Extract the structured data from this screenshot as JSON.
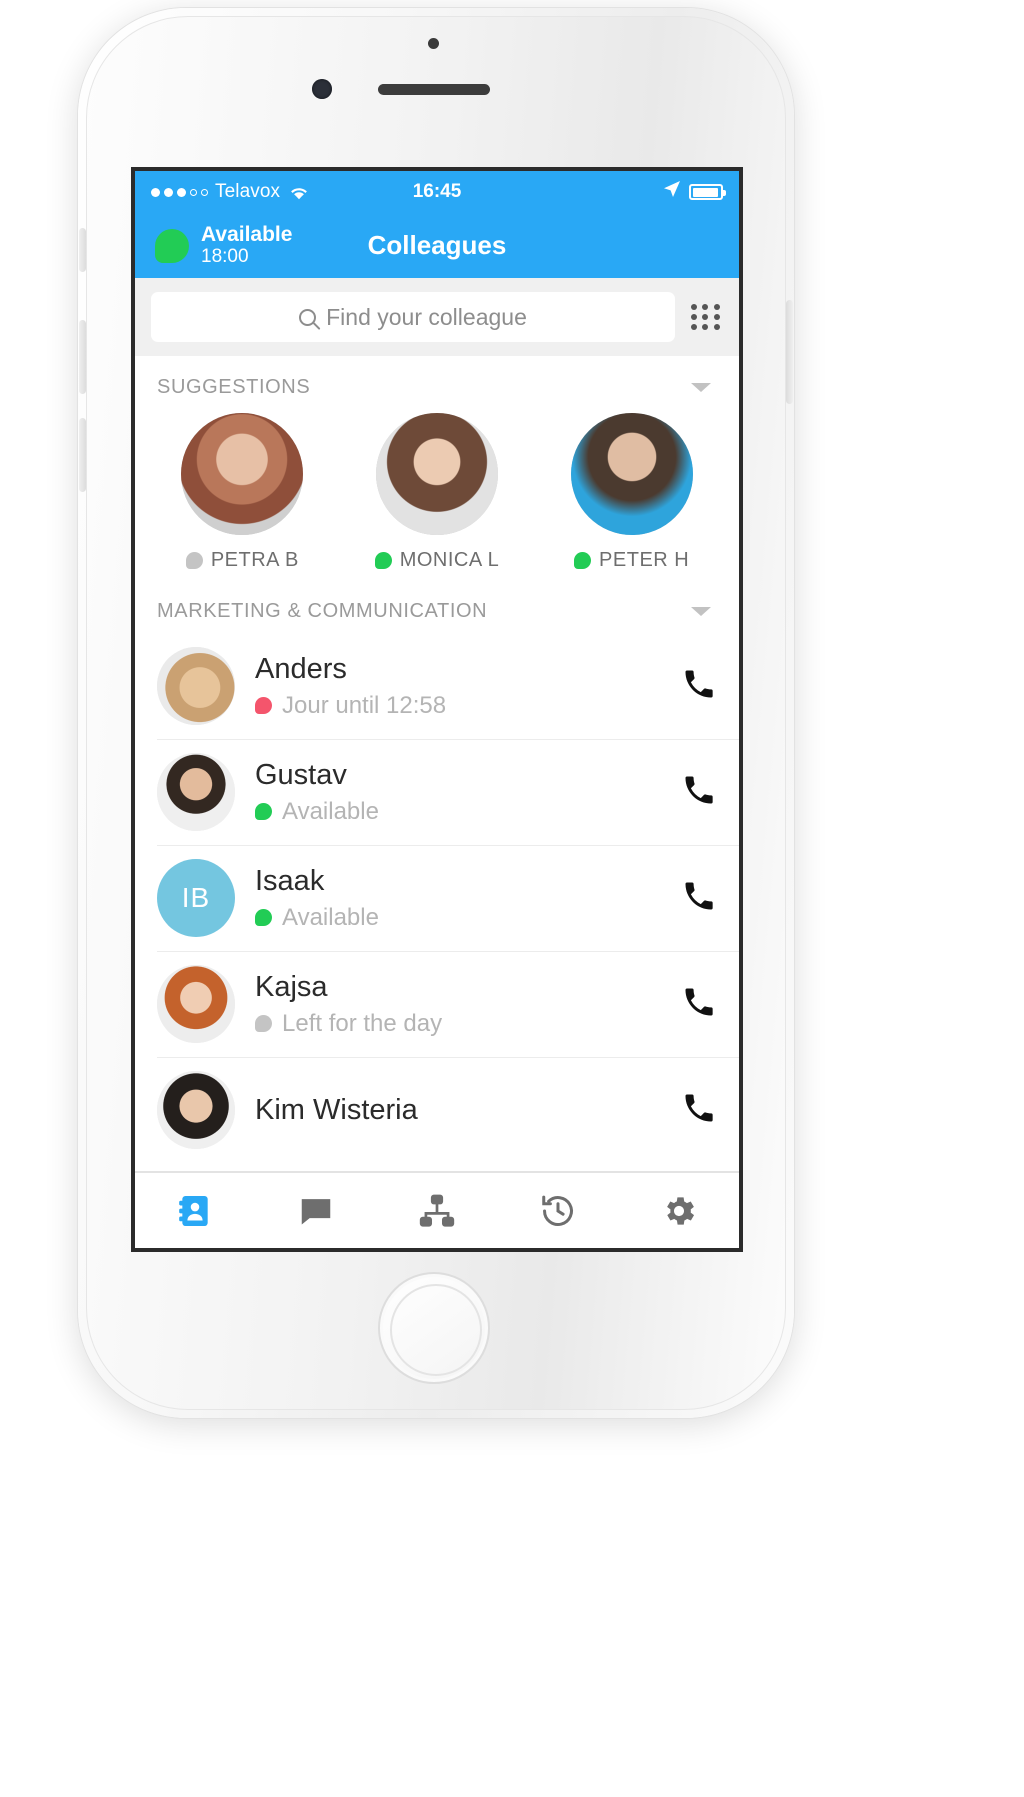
{
  "device": {
    "frame": "iphone-white"
  },
  "status_bar": {
    "signal_dots_filled": 3,
    "signal_dots_total": 5,
    "carrier": "Telavox",
    "wifi_icon": "wifi-icon",
    "time": "16:45",
    "location_icon": "location-arrow-icon",
    "battery_icon": "battery-icon",
    "battery_level_pct": 85
  },
  "navbar": {
    "presence_label": "Available",
    "presence_time": "18:00",
    "presence_color": "#22cc55",
    "title": "Colleagues",
    "background": "#29a8f5"
  },
  "search": {
    "placeholder": "Find your colleague",
    "value": "",
    "search_icon": "search-icon",
    "dialpad_icon": "dialpad-icon"
  },
  "sections": [
    {
      "title": "SUGGESTIONS",
      "collapse_icon": "chevron-down-icon",
      "suggestions": [
        {
          "name": "PETRA B",
          "presence": "grey",
          "avatar": "f-petra"
        },
        {
          "name": "MONICA L",
          "presence": "green",
          "avatar": "f-monica"
        },
        {
          "name": "PETER H",
          "presence": "green",
          "avatar": "f-peter"
        }
      ]
    },
    {
      "title": "MARKETING & COMMUNICATION",
      "collapse_icon": "chevron-down-icon",
      "contacts": [
        {
          "name": "Anders",
          "status": "Jour until 12:58",
          "presence": "red",
          "avatar": "f-dog",
          "initials": "",
          "call_icon": "phone-icon"
        },
        {
          "name": "Gustav",
          "status": "Available",
          "presence": "green",
          "avatar": "f-gustav",
          "initials": "",
          "call_icon": "phone-icon"
        },
        {
          "name": "Isaak",
          "status": "Available",
          "presence": "green",
          "avatar": "",
          "initials": "IB",
          "call_icon": "phone-icon"
        },
        {
          "name": "Kajsa",
          "status": "Left for the day",
          "presence": "grey",
          "avatar": "f-kajsa",
          "initials": "",
          "call_icon": "phone-icon"
        },
        {
          "name": "Kim Wisteria",
          "status": "",
          "presence": "grey",
          "avatar": "f-kim",
          "initials": "",
          "call_icon": "phone-icon"
        }
      ]
    }
  ],
  "tabbar": {
    "active_index": 0,
    "active_color": "#29a8f5",
    "inactive_color": "#6e6e6e",
    "items": [
      {
        "icon": "contacts-icon"
      },
      {
        "icon": "chat-icon"
      },
      {
        "icon": "org-chart-icon"
      },
      {
        "icon": "history-icon"
      },
      {
        "icon": "settings-gear-icon"
      }
    ]
  },
  "colors": {
    "brand_blue": "#29a8f5",
    "presence_green": "#22cc55",
    "presence_red": "#f4556c",
    "presence_grey": "#c4c4c4",
    "initials_bg": "#74c6e0"
  }
}
